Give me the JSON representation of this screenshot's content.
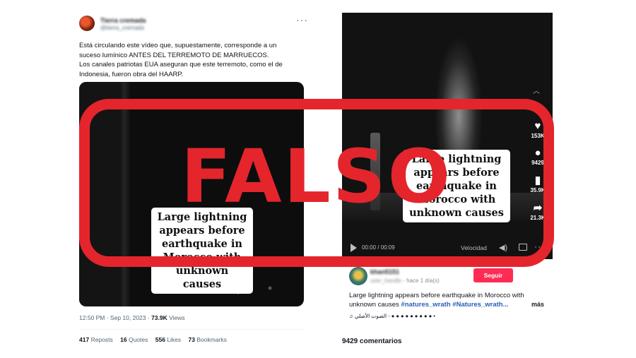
{
  "tweet": {
    "display_name": "Tierra cremada",
    "handle": "@tierra_cremada",
    "more_label": "···",
    "text_lines": [
      "Está circulando este vídeo que, supuestamente, corresponde a un",
      "suceso lumínico ANTES DEL TERREMOTO DE MARRUECOS.",
      "Los canales patriotas EUA aseguran que este terremoto, como el de",
      "Indonesia, fueron obra del HAARP."
    ],
    "media_caption": "Large lightning appears before earthquake in Morocco with unknown causes",
    "timestamp": "12:50 PM · Sep 10, 2023 · ",
    "views_count": "73.9K",
    "views_label": "Views",
    "stats": [
      {
        "count": "417",
        "label": "Reposts"
      },
      {
        "count": "16",
        "label": "Quotes"
      },
      {
        "count": "556",
        "label": "Likes"
      },
      {
        "count": "73",
        "label": "Bookmarks"
      }
    ]
  },
  "tiktok": {
    "video_caption": "Large lightning appears before earthquake in Morocco with unknown causes",
    "side_actions": [
      {
        "icon": "heart-icon",
        "glyph": "♥",
        "count": "153K"
      },
      {
        "icon": "comment-icon",
        "glyph": "●",
        "count": "9429"
      },
      {
        "icon": "bookmark-icon",
        "glyph": "▮",
        "count": "35.9K"
      },
      {
        "icon": "share-icon",
        "glyph": "➦",
        "count": "21.3K"
      }
    ],
    "controls": {
      "time": "00:00 / 00:09",
      "speed_label": "Velocidad"
    },
    "author_name": "khan5151",
    "author_sub_blur": "user_handle",
    "author_date": " · hace 1 día(s)",
    "follow_label": "Seguir",
    "description": "Large lightning appears before earthquake in Morocco with unknown causes ",
    "hashtags": [
      "#natures_wrath",
      "#Natures_wrath..."
    ],
    "more_label": "más",
    "music": "♫ الصوت الأصلي - ● ● ● ● ● ● ● ● ● •",
    "comments_label": "9429 comentarios"
  },
  "stamp": {
    "text": "FALSO",
    "color": "#e4252c"
  }
}
